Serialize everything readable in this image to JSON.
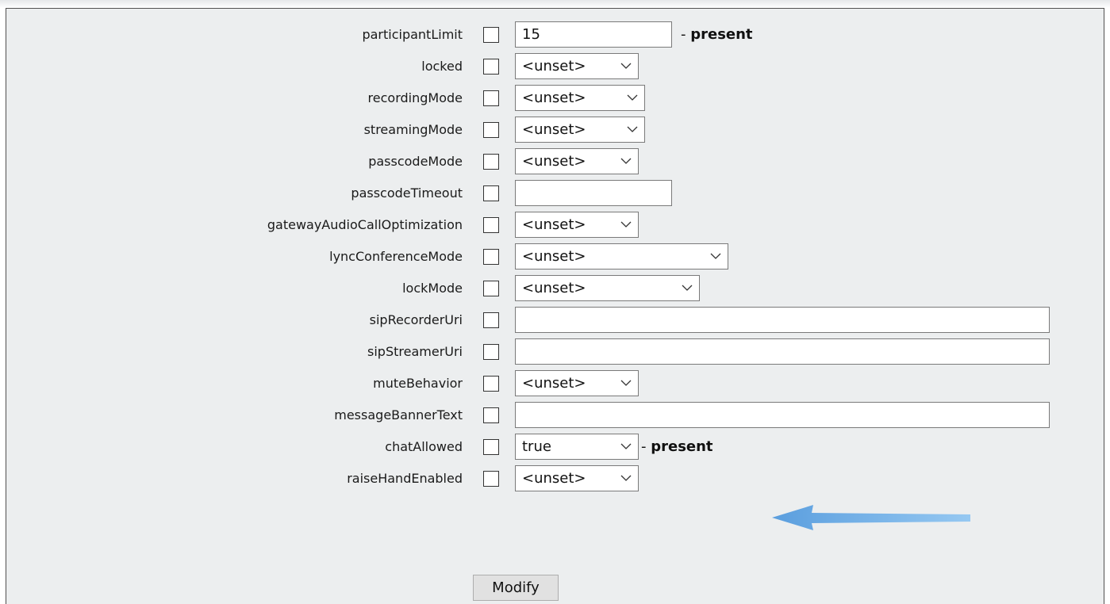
{
  "form": {
    "rows": [
      {
        "label": "participantLimit",
        "type": "text",
        "value": "15",
        "suffix_dash": " - ",
        "suffix_bold": "present"
      },
      {
        "label": "locked",
        "type": "select",
        "value": "<unset>"
      },
      {
        "label": "recordingMode",
        "type": "select",
        "value": "<unset>"
      },
      {
        "label": "streamingMode",
        "type": "select",
        "value": "<unset>"
      },
      {
        "label": "passcodeMode",
        "type": "select",
        "value": "<unset>"
      },
      {
        "label": "passcodeTimeout",
        "type": "text",
        "value": ""
      },
      {
        "label": "gatewayAudioCallOptimization",
        "type": "select",
        "value": "<unset>"
      },
      {
        "label": "lyncConferenceMode",
        "type": "select",
        "value": "<unset>"
      },
      {
        "label": "lockMode",
        "type": "select",
        "value": "<unset>"
      },
      {
        "label": "sipRecorderUri",
        "type": "text",
        "value": ""
      },
      {
        "label": "sipStreamerUri",
        "type": "text",
        "value": ""
      },
      {
        "label": "muteBehavior",
        "type": "select",
        "value": "<unset>"
      },
      {
        "label": "messageBannerText",
        "type": "text",
        "value": ""
      },
      {
        "label": "chatAllowed",
        "type": "select",
        "value": "true",
        "suffix_dash": " - ",
        "suffix_bold": "present"
      },
      {
        "label": "raiseHandEnabled",
        "type": "select",
        "value": "<unset>"
      }
    ],
    "submit_label": "Modify"
  },
  "colors": {
    "panel_bg": "#eceeef",
    "arrow": "#5aa6e6"
  }
}
